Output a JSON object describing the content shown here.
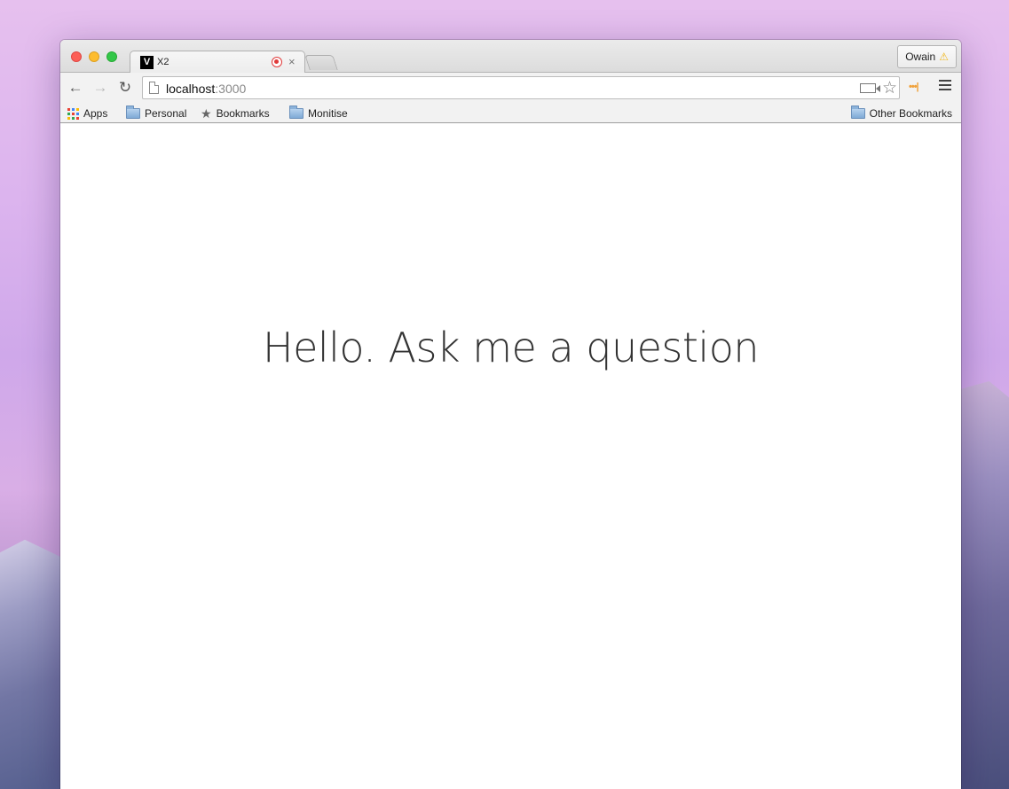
{
  "browser": {
    "tab": {
      "favicon_letter": "V",
      "title": "X2",
      "close_glyph": "×"
    },
    "profile": {
      "name": "Owain",
      "warning_glyph": "⚠"
    },
    "address": {
      "host": "localhost",
      "port": ":3000"
    },
    "nav": {
      "back_glyph": "←",
      "forward_glyph": "→",
      "reload_glyph": "↻",
      "star_glyph": "☆",
      "ext_glyph": "•••|"
    },
    "bookmarks": {
      "items": [
        {
          "label": "Apps",
          "icon": "apps-grid-icon"
        },
        {
          "label": "Personal",
          "icon": "folder-icon"
        },
        {
          "label": "Bookmarks",
          "icon": "star-icon"
        },
        {
          "label": "Monitise",
          "icon": "folder-icon"
        }
      ],
      "other": {
        "label": "Other Bookmarks",
        "icon": "folder-icon"
      }
    }
  },
  "page": {
    "heading": "Hello. Ask me a question"
  },
  "colors": {
    "accent_record": "#e03a3a",
    "warning": "#f1b81d",
    "extension": "#f0a13a",
    "text": "#333333"
  },
  "apps_grid_colors": [
    "#e94235",
    "#4285f4",
    "#fbbc05",
    "#34a853",
    "#e94235",
    "#4285f4",
    "#fbbc05",
    "#34a853",
    "#ea4335"
  ]
}
